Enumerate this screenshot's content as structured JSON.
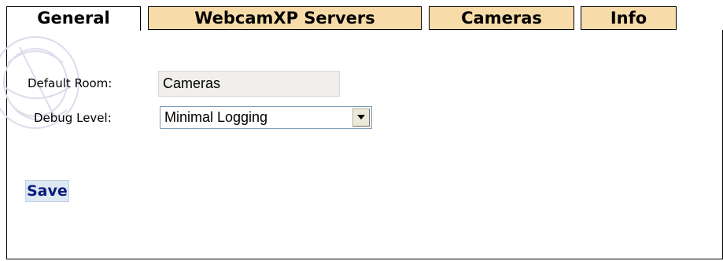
{
  "tabs": [
    {
      "label": "General",
      "active": true
    },
    {
      "label": "WebcamXP Servers",
      "active": false
    },
    {
      "label": "Cameras",
      "active": false
    },
    {
      "label": "Info",
      "active": false
    }
  ],
  "form": {
    "default_room": {
      "label": "Default Room:",
      "value": "Cameras"
    },
    "debug_level": {
      "label": "Debug Level:",
      "selected": "Minimal Logging"
    }
  },
  "actions": {
    "save_label": "Save"
  },
  "colors": {
    "tab_inactive_bg": "#f7dcaa",
    "save_text": "#0b1d7a",
    "save_bg": "#dde8f3"
  }
}
